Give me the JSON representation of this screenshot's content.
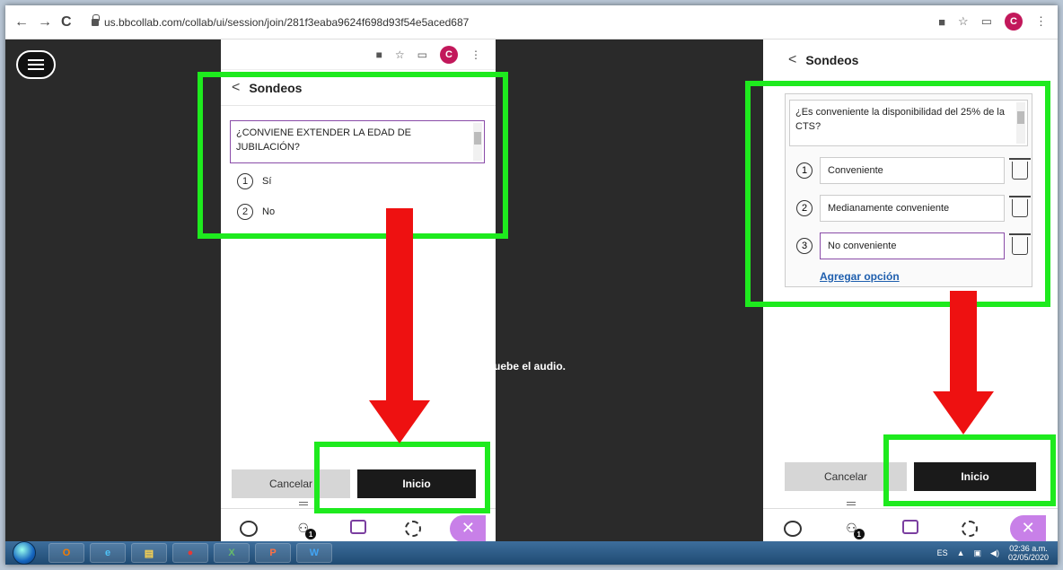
{
  "browser": {
    "url": "us.bbcollab.com/collab/ui/session/join/281f3eaba9624f698d93f54e5aced687",
    "profile_initial": "C"
  },
  "background": {
    "audio_text": "uebe el audio."
  },
  "left_panel": {
    "title": "Sondeos",
    "question": "¿CONVIENE EXTENDER LA EDAD DE JUBILACIÓN?",
    "options": [
      {
        "num": "1",
        "label": "Sí"
      },
      {
        "num": "2",
        "label": "No"
      }
    ],
    "cancel_label": "Cancelar",
    "start_label": "Inicio",
    "people_badge": "1"
  },
  "right_panel": {
    "title": "Sondeos",
    "question": "¿Es conveniente la disponibilidad del 25% de la CTS?",
    "options": [
      {
        "num": "1",
        "label": "Conveniente"
      },
      {
        "num": "2",
        "label": "Medianamente conveniente"
      },
      {
        "num": "3",
        "label": "No conveniente"
      }
    ],
    "add_option": "Agregar opción",
    "cancel_label": "Cancelar",
    "start_label": "Inicio",
    "people_badge": "1"
  },
  "taskbar": {
    "language": "ES",
    "time": "02:36 a.m.",
    "date": "02/05/2020"
  },
  "colors": {
    "highlight_box": "#1eea1e",
    "arrow": "#ee1111",
    "accent_purple": "#7b3fa0"
  }
}
